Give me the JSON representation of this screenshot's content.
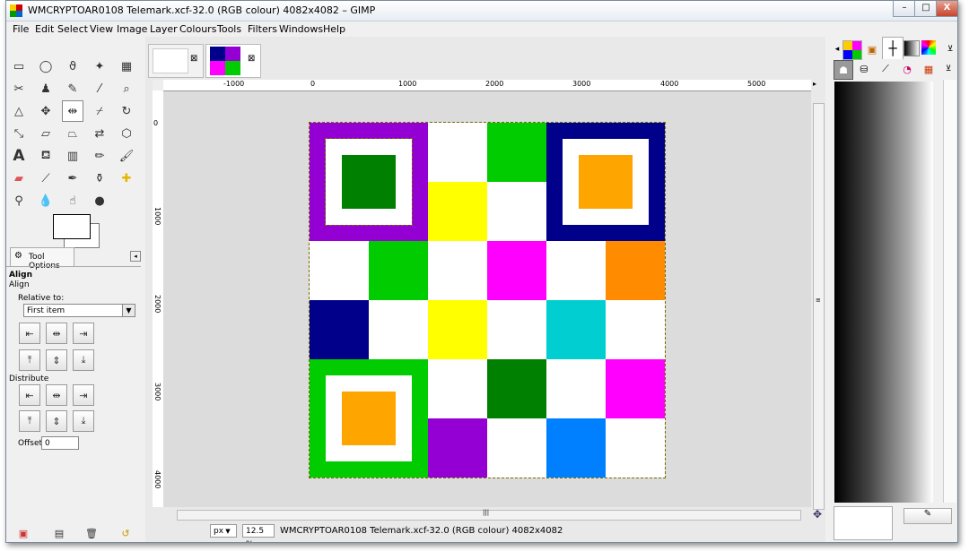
{
  "window": {
    "title": "WMCRYPTOAR0108 Telemark.xcf-32.0 (RGB colour) 4082x4082 – GIMP",
    "controls": {
      "minimize": "–",
      "maximize": "□",
      "close": "X"
    }
  },
  "menu": [
    {
      "label": "File"
    },
    {
      "label": "Edit"
    },
    {
      "label": "Select"
    },
    {
      "label": "View"
    },
    {
      "label": "Image"
    },
    {
      "label": "Layer"
    },
    {
      "label": "Colours"
    },
    {
      "label": "Tools"
    },
    {
      "label": "Filters"
    },
    {
      "label": "Windows"
    },
    {
      "label": "Help"
    }
  ],
  "tool_options": {
    "tab_label": "Tool Options",
    "header": "Align",
    "subheader": "Align",
    "relative_to_label": "Relative to:",
    "relative_to_value": "First item",
    "distribute_label": "Distribute",
    "offset_label": "Offset:",
    "offset_value": "0"
  },
  "ruler": {
    "h": [
      "-1000",
      "0",
      "1000",
      "2000",
      "3000",
      "4000",
      "5000"
    ],
    "v": [
      "0",
      "1000",
      "2000",
      "3000",
      "4000"
    ]
  },
  "status": {
    "unit": "px",
    "zoom": "12.5 %",
    "text": "WMCRYPTOAR0108 Telemark.xcf-32.0 (RGB colour) 4082x4082"
  },
  "colors": {
    "purple": "#9400d3",
    "green": "#00cc00",
    "dark_green": "#008000",
    "navy": "#00008b",
    "orange": "#ffa500",
    "dark_orange": "#ff8c00",
    "yellow": "#ffff00",
    "magenta": "#ff00ff",
    "cyan": "#00ced1",
    "blue": "#0080ff",
    "white": "#ffffff"
  },
  "image_grid": [
    [
      "purple-frame",
      "purple-frame",
      "white",
      "green",
      "navy-frame",
      "navy-frame"
    ],
    [
      "purple-frame",
      "purple-frame",
      "yellow",
      "white",
      "navy-frame",
      "navy-frame"
    ],
    [
      "white",
      "green",
      "white",
      "magenta",
      "white",
      "dark_orange"
    ],
    [
      "navy",
      "white",
      "yellow",
      "white",
      "cyan",
      "white"
    ],
    [
      "green-frame",
      "green-frame",
      "white",
      "dark_green",
      "white",
      "magenta"
    ],
    [
      "green-frame",
      "green-frame",
      "purple",
      "white",
      "blue",
      "white"
    ]
  ]
}
